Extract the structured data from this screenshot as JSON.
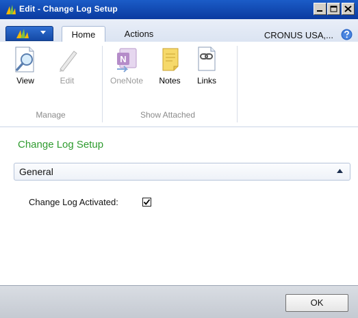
{
  "window": {
    "title": "Edit - Change Log Setup",
    "min_icon": "minimize-icon",
    "max_icon": "maximize-icon",
    "close_icon": "close-icon"
  },
  "ribbon": {
    "tabs": [
      {
        "label": "Home",
        "active": true
      },
      {
        "label": "Actions",
        "active": false
      }
    ],
    "company": "CRONUS USA,...",
    "groups": [
      {
        "label": "Manage",
        "buttons": [
          {
            "label": "View",
            "icon": "view-icon",
            "enabled": true
          },
          {
            "label": "Edit",
            "icon": "edit-pencil-icon",
            "enabled": false
          }
        ]
      },
      {
        "label": "Show Attached",
        "buttons": [
          {
            "label": "OneNote",
            "icon": "onenote-icon",
            "enabled": false
          },
          {
            "label": "Notes",
            "icon": "notes-icon",
            "enabled": true
          },
          {
            "label": "Links",
            "icon": "links-icon",
            "enabled": true
          }
        ]
      }
    ]
  },
  "page": {
    "title": "Change Log Setup",
    "fasttab": {
      "label": "General",
      "fields": [
        {
          "label": "Change Log Activated:",
          "checked": true
        }
      ]
    }
  },
  "footer": {
    "ok_label": "OK"
  },
  "colors": {
    "title_bar": "#0a3aa0",
    "page_title": "#2e9b2e"
  }
}
